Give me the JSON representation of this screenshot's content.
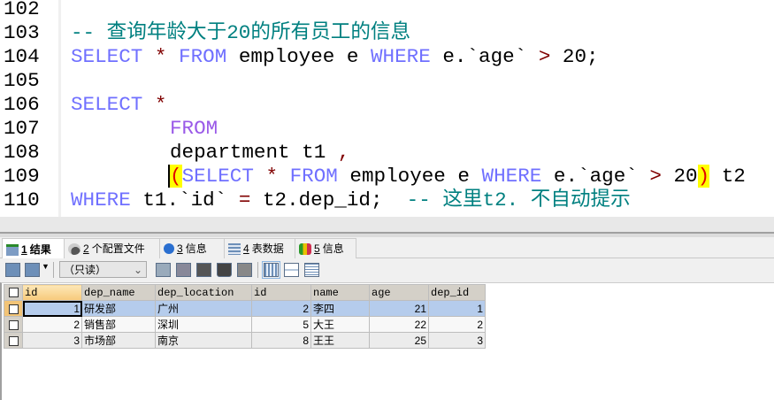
{
  "editor": {
    "line_numbers": [
      "102",
      "103",
      "104",
      "105",
      "106",
      "107",
      "108",
      "109",
      "110"
    ],
    "l103": "-- 查询年龄大于20的所有员工的信息",
    "l104": {
      "a": "SELECT",
      "b": " * ",
      "c": "FROM",
      "d": " employee e ",
      "e": "WHERE",
      "f": " e.`age` ",
      "g": ">",
      "h": " 20;"
    },
    "l106": {
      "a": "SELECT",
      "b": " *"
    },
    "l107": {
      "a": "FROM"
    },
    "l108": {
      "a": "department t1 ",
      "b": ","
    },
    "l109": {
      "p1": "(",
      "a": "SELECT",
      "b": " * ",
      "c": "FROM",
      "d": " employee e ",
      "e": "WHERE",
      "f": " e.`age` ",
      "g": ">",
      "h": " 20",
      "p2": ")",
      "i": " t2"
    },
    "l110": {
      "a": "WHERE",
      "b": " t1.`id` ",
      "c": "=",
      "d": " t2.dep_id;  ",
      "e": "-- 这里t2. 不自动提示"
    }
  },
  "tabs": [
    {
      "num": "1",
      "label": " 结果"
    },
    {
      "num": "2",
      "label": " 个配置文件"
    },
    {
      "num": "3",
      "label": " 信息"
    },
    {
      "num": "4",
      "label": " 表数据"
    },
    {
      "num": "5",
      "label": " 信息"
    }
  ],
  "toolbar": {
    "mode": "（只读）"
  },
  "grid": {
    "columns": [
      "id",
      "dep_name",
      "dep_location",
      "id",
      "name",
      "age",
      "dep_id"
    ],
    "rows": [
      [
        "1",
        "研发部",
        "广州",
        "2",
        "李四",
        "21",
        "1"
      ],
      [
        "2",
        "销售部",
        "深圳",
        "5",
        "大王",
        "22",
        "2"
      ],
      [
        "3",
        "市场部",
        "南京",
        "8",
        "王王",
        "25",
        "3"
      ]
    ]
  }
}
